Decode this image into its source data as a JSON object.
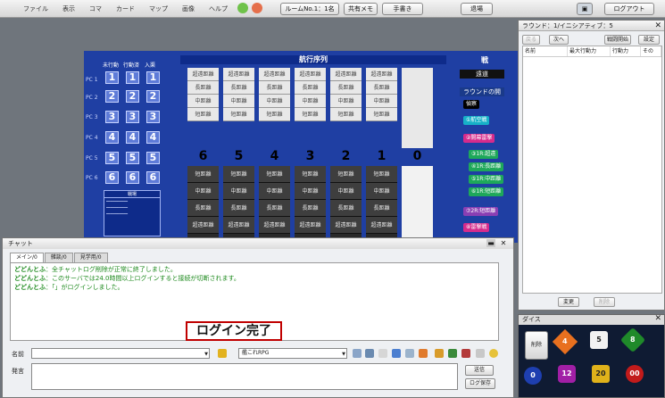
{
  "menubar": {
    "items": [
      "ファイル",
      "表示",
      "コマ",
      "カード",
      "マップ",
      "画像",
      "ヘルプ"
    ],
    "room_button": "ルームNo.1：1名",
    "shared_memo_button": "共有メモ",
    "handout_button": "手書き",
    "leave_button": "退場",
    "logout_button": "ログアウト"
  },
  "board": {
    "title": "航行序列",
    "header_labels": [
      "未行動",
      "行動済",
      "入渠"
    ],
    "pc_labels": [
      "PC 1",
      "PC 2",
      "PC 3",
      "PC 4",
      "PC 5",
      "PC 6"
    ],
    "pc_numbers": [
      "1",
      "2",
      "3",
      "4",
      "5",
      "6"
    ],
    "column_numbers": [
      "6",
      "5",
      "4",
      "3",
      "2",
      "1",
      "0"
    ],
    "light_cells": [
      "超遠距離",
      "長距離",
      "中距離",
      "短距離"
    ],
    "dark_cells": [
      "短距離",
      "中距離",
      "長距離",
      "超遠距離"
    ],
    "legend_title": "戦場",
    "side_title": "戦",
    "side_black_1": "遠道",
    "side_black_2": "ラウンドの開",
    "side_tags": [
      "偵察",
      "①航空戦",
      "②開幕雷撃",
      "③1R:超遠",
      "④1R:長距離",
      "⑤1R:中距離",
      "⑥1R:短距離",
      "⑦2R:短距離",
      "⑧雷撃戦"
    ]
  },
  "round_window": {
    "title": "ラウンド：1/イニシアティブ：5",
    "prev_button": "戻る",
    "next_button": "次へ",
    "start_button": "戦闘開始",
    "settings_button": "設定",
    "columns": [
      "名前",
      "最大行動力",
      "行動力",
      "その"
    ],
    "change_button": "変更",
    "delete_button": "削除"
  },
  "dice": {
    "title": "ダイス",
    "clear_button": "削除",
    "dice_values": [
      "4",
      "5",
      "8",
      "0",
      "12",
      "20",
      "00"
    ]
  },
  "chat": {
    "title": "チャット",
    "tabs": [
      "メイン/0",
      "雑談/0",
      "見学用/0"
    ],
    "log": [
      {
        "name": "どどんとふ",
        "text": "：全チャットログ削除が正常に終了しました。"
      },
      {
        "name": "どどんとふ",
        "text": "：このサーバでは24.0時間以上ログインすると接続が切断されます。"
      },
      {
        "name": "どどんとふ",
        "text": "：「」がログインしました。"
      }
    ],
    "login_notice": "ログイン完了",
    "name_label": "名前",
    "message_label": "発言",
    "system_select": "艦これRPG",
    "send_button": "送信",
    "save_log_button": "ログ保存"
  },
  "colors": {
    "board_blue": "#1f3fa3",
    "accent_red": "#c00000",
    "chat_green": "#1d8a1d"
  }
}
